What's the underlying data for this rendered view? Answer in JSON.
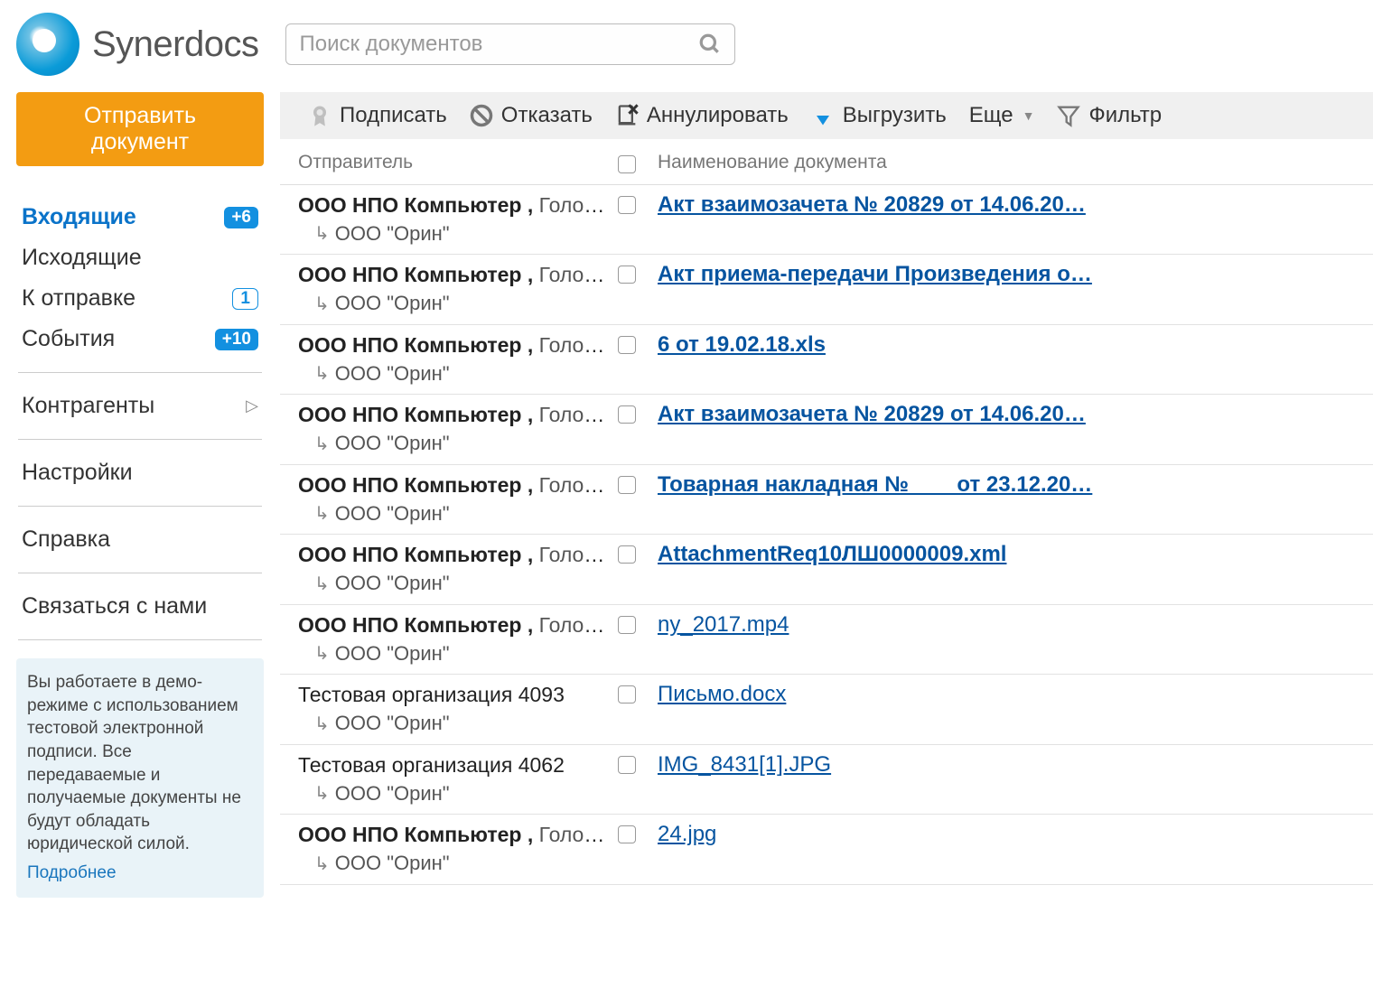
{
  "brand": "Synerdocs",
  "search": {
    "placeholder": "Поиск документов"
  },
  "send_button": "Отправить документ",
  "nav": {
    "inbox": {
      "label": "Входящие",
      "badge": "+6"
    },
    "outbox": {
      "label": "Исходящие"
    },
    "drafts": {
      "label": "К отправке",
      "badge": "1"
    },
    "events": {
      "label": "События",
      "badge": "+10"
    },
    "contragents": {
      "label": "Контрагенты"
    },
    "settings": {
      "label": "Настройки"
    },
    "help": {
      "label": "Справка"
    },
    "contact": {
      "label": "Связаться с нами"
    }
  },
  "demo": {
    "text": "Вы работаете в демо-режиме с использованием тестовой электронной подписи. Все передаваемые и получаемые документы не будут обладать юридической силой.",
    "more": "Подробнее"
  },
  "toolbar": {
    "sign": "Подписать",
    "reject": "Отказать",
    "annul": "Аннулировать",
    "download": "Выгрузить",
    "more": "Еще",
    "filter": "Фильтр"
  },
  "columns": {
    "sender": "Отправитель",
    "doc": "Наименование документа"
  },
  "sender_parts": {
    "npo_bold": "ООО НПО Компьютер ,",
    "npo_rest": " Голов…",
    "npo_rest2": " Головн…",
    "test1": "Тестовая организация 4093",
    "test2": "Тестовая организация 4062",
    "sub": "ООО \"Орин\""
  },
  "rows": [
    {
      "sender_type": "npo",
      "rest_key": "npo_rest",
      "doc": "Акт взаимозачета № 20829 от 14.06.20…",
      "unread": true
    },
    {
      "sender_type": "npo",
      "rest_key": "npo_rest",
      "doc": "Акт приема-передачи Произведения о…",
      "unread": true
    },
    {
      "sender_type": "npo",
      "rest_key": "npo_rest",
      "doc": "6 от 19.02.18.xls",
      "unread": true
    },
    {
      "sender_type": "npo",
      "rest_key": "npo_rest",
      "doc": "Акт взаимозачета № 20829 от 14.06.20…",
      "unread": true
    },
    {
      "sender_type": "npo",
      "rest_key": "npo_rest",
      "doc": "Товарная накладная № ___ от 23.12.20…",
      "unread": true
    },
    {
      "sender_type": "npo",
      "rest_key": "npo_rest",
      "doc": "AttachmentReq10ЛШ0000009.xml",
      "unread": true
    },
    {
      "sender_type": "npo",
      "rest_key": "npo_rest2",
      "doc": "ny_2017.mp4",
      "unread": false
    },
    {
      "sender_type": "plain",
      "plain_key": "test1",
      "doc": "Письмо.docx",
      "unread": false
    },
    {
      "sender_type": "plain",
      "plain_key": "test2",
      "doc": "IMG_8431[1].JPG",
      "unread": false
    },
    {
      "sender_type": "npo",
      "rest_key": "npo_rest2",
      "doc": "24.jpg",
      "unread": false
    }
  ]
}
